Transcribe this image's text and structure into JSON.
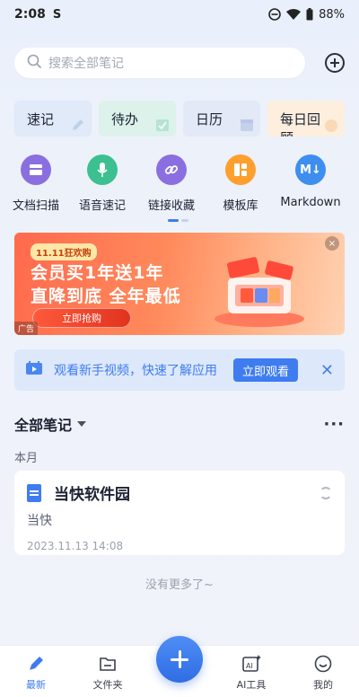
{
  "status_bar": {
    "time": "2:08",
    "app_indicator": "S",
    "battery": "88%"
  },
  "search": {
    "placeholder": "搜索全部笔记"
  },
  "quick_cards": [
    {
      "label": "速记"
    },
    {
      "label": "待办"
    },
    {
      "label": "日历"
    },
    {
      "label": "每日回顾"
    }
  ],
  "tools": [
    {
      "label": "文档扫描",
      "icon": "scan-doc-icon",
      "color": "#8b6fe0"
    },
    {
      "label": "语音速记",
      "icon": "microphone-icon",
      "color": "#3cc08f"
    },
    {
      "label": "链接收藏",
      "icon": "link-icon",
      "color": "#8b6fe0"
    },
    {
      "label": "模板库",
      "icon": "template-icon",
      "color": "#ff9f2e"
    },
    {
      "label": "Markdown",
      "icon": "markdown-icon",
      "icon_text": "M↓",
      "color": "#3e8ef0"
    }
  ],
  "banner": {
    "tag": "11.11狂欢购",
    "line1": "会员买1年送1年",
    "line2": "直降到底 全年最低",
    "cta": "立即抢购",
    "ad_label": "广告",
    "close": "×"
  },
  "video_bar": {
    "text": "观看新手视频，快速了解应用",
    "button": "立即观看",
    "close": "✕"
  },
  "notes_header": {
    "title": "全部笔记",
    "more": "···"
  },
  "section_label": "本月",
  "notes": [
    {
      "title": "当快软件园",
      "body": "当快",
      "date": "2023.11.13 14:08"
    }
  ],
  "no_more": "没有更多了~",
  "bottom_nav": [
    {
      "label": "最新",
      "icon": "latest-icon",
      "active": true
    },
    {
      "label": "文件夹",
      "icon": "folder-icon"
    },
    {
      "label": "AI工具",
      "icon": "ai-tools-icon"
    },
    {
      "label": "我的",
      "icon": "profile-icon"
    }
  ],
  "colors": {
    "accent": "#3e7cf0",
    "banner": "#ff6a4d"
  }
}
